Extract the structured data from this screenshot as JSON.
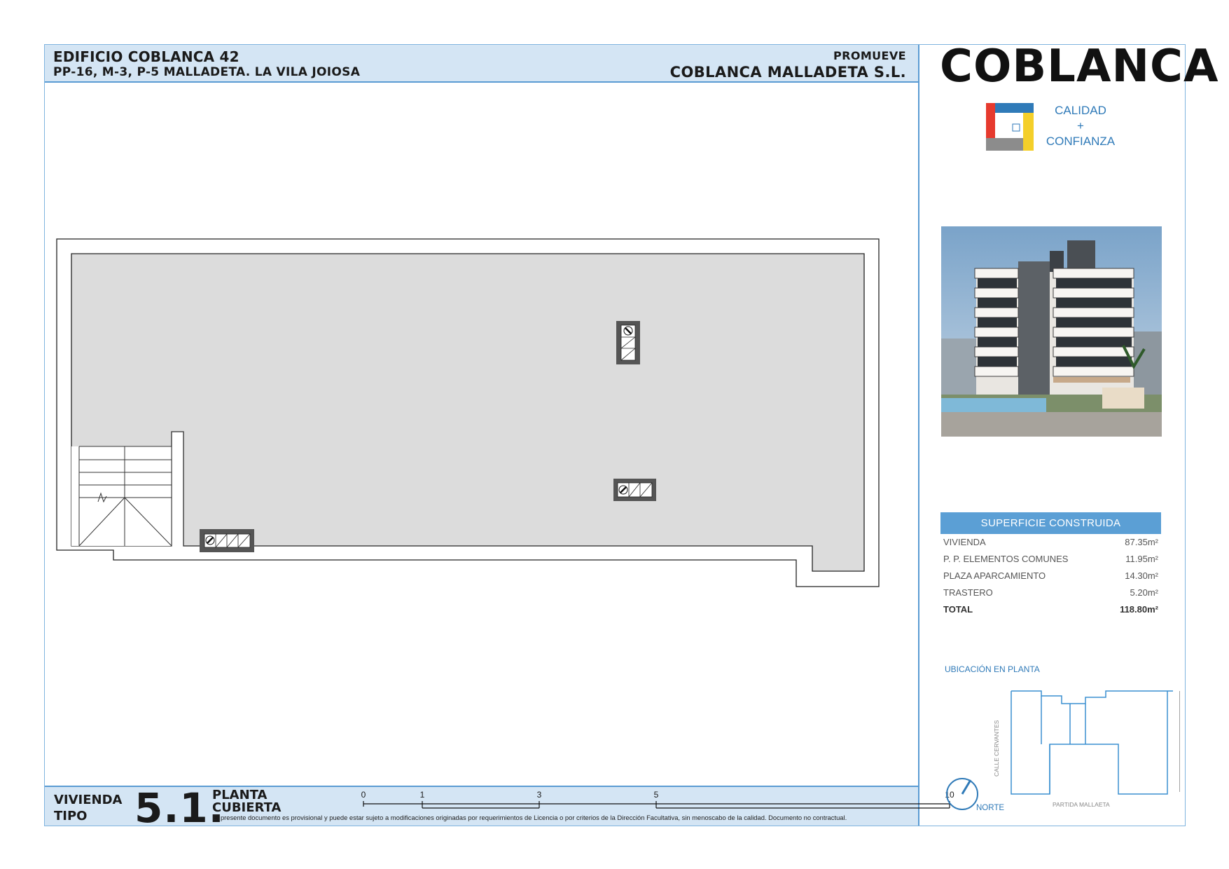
{
  "header": {
    "building_name": "EDIFICIO COBLANCA 42",
    "building_address": "PP-16, M-3, P-5 MALLADETA. LA VILA JOIOSA",
    "promoter_label": "PROMUEVE",
    "promoter_name": "COBLANCA MALLADETA S.L."
  },
  "brand": {
    "name": "COBLANCA",
    "tagline_1": "CALIDAD",
    "tagline_2": "+",
    "tagline_3": "CONFIANZA",
    "colors": {
      "red": "#e63a2e",
      "blue": "#2f7ab8",
      "yellow": "#f4cf2a",
      "gray": "#8c8c8c"
    }
  },
  "area": {
    "title": "SUPERFICIE CONSTRUIDA",
    "rows": [
      {
        "label": "VIVIENDA",
        "value": "87.35m²"
      },
      {
        "label": "P. P. ELEMENTOS COMUNES",
        "value": "11.95m²"
      },
      {
        "label": "PLAZA APARCAMIENTO",
        "value": "14.30m²"
      },
      {
        "label": "TRASTERO",
        "value": "5.20m²"
      }
    ],
    "total_label": "TOTAL",
    "total_value": "118.80m²"
  },
  "location": {
    "title": "UBICACIÓN EN PLANTA",
    "street_1": "CALLE CERVANTES",
    "street_2": "PARTIDA MALLAETA",
    "north": "NORTE"
  },
  "footer": {
    "unit_label": "VIVIENDA\nTIPO",
    "unit_number": "5.1.",
    "plan_label": "PLANTA\nCUBIERTA",
    "scale_ticks": [
      "0",
      "1",
      "3",
      "5",
      "10"
    ],
    "disclaimer": "El presente documento es provisional y puede estar sujeto a modificaciones originadas por requerimientos de Licencia o por criterios de la Dirección Facultativa, sin menoscabo de la calidad. Documento no contractual."
  }
}
